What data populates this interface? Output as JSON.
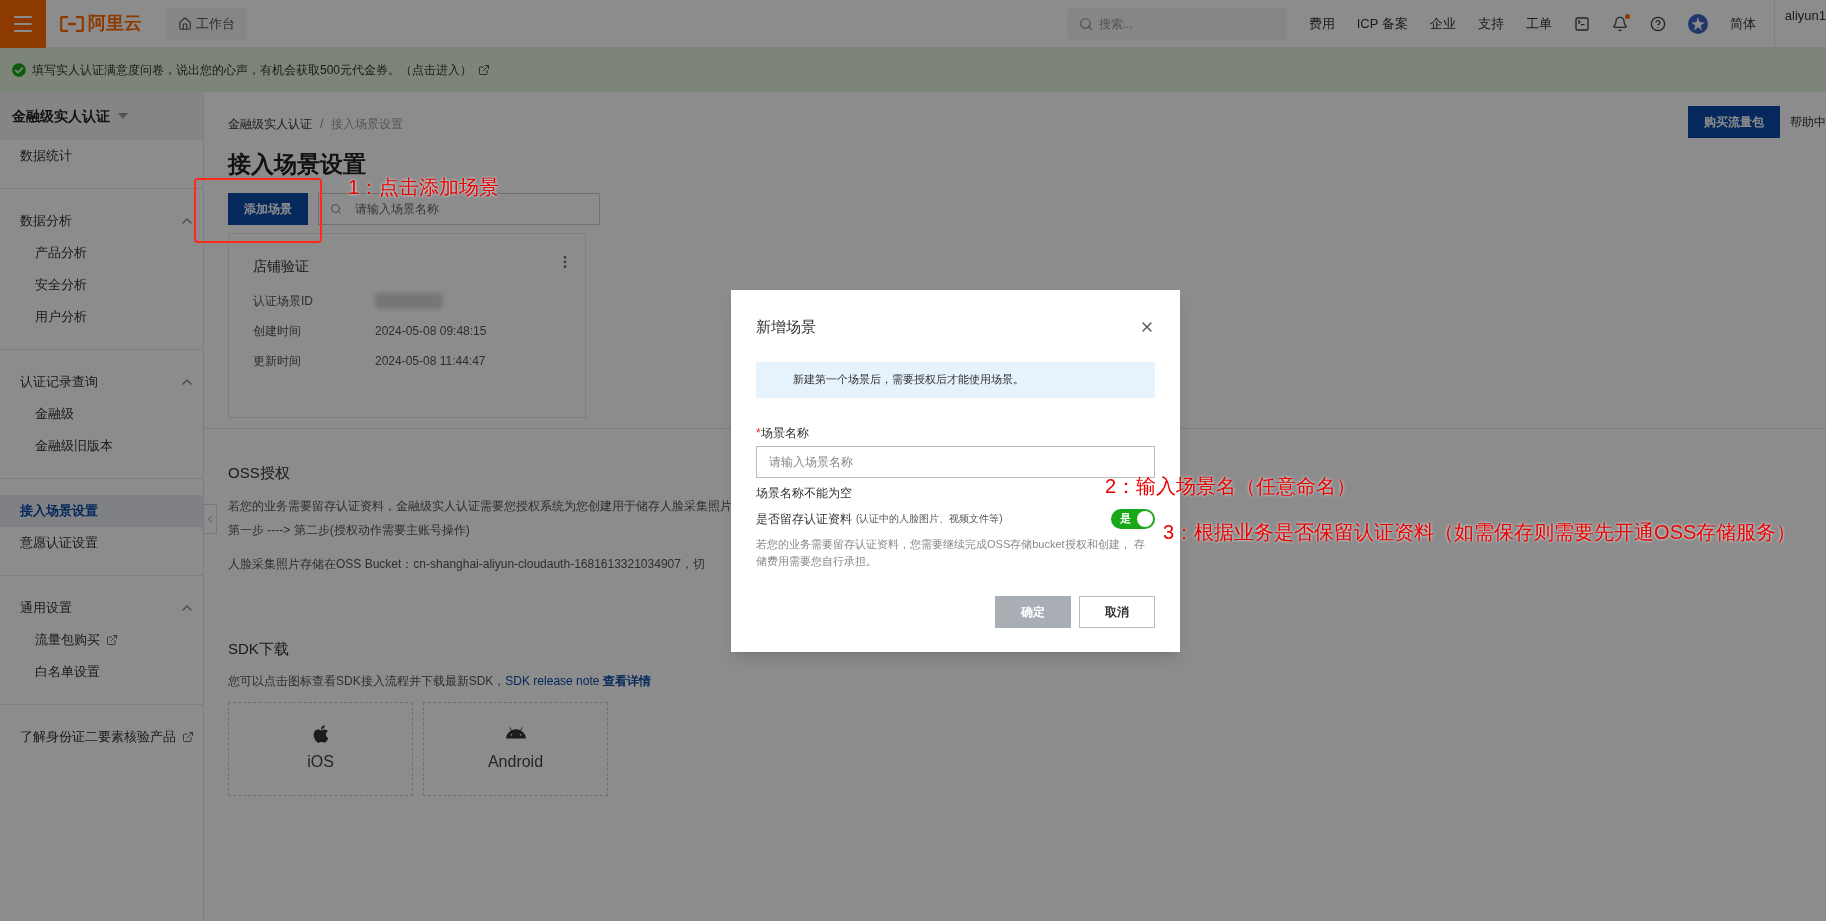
{
  "top_bar": {
    "logo_text": "阿里云",
    "workbench": "工作台",
    "search_placeholder": "搜索...",
    "nav_items": [
      "费用",
      "ICP 备案",
      "企业",
      "支持",
      "工单"
    ],
    "language": "简体",
    "user": "aliyun1",
    "has_notification": true
  },
  "notice": {
    "text": "填写实人认证满意度问卷，说出您的心声，有机会获取500元代金券。（点击进入）"
  },
  "sidebar": {
    "title": "金融级实人认证",
    "sections": [
      {
        "items": [
          {
            "label": "数据统计",
            "selected": false,
            "external": false
          }
        ]
      },
      {
        "items": [
          {
            "label": "数据分析",
            "selected": false,
            "external": false,
            "expanded": true,
            "children": [
              {
                "label": "产品分析",
                "selected": false,
                "external": false
              },
              {
                "label": "安全分析",
                "selected": false,
                "external": false
              },
              {
                "label": "用户分析",
                "selected": false,
                "external": false
              }
            ]
          }
        ]
      },
      {
        "items": [
          {
            "label": "认证记录查询",
            "selected": false,
            "external": false,
            "expanded": true,
            "children": [
              {
                "label": "金融级",
                "selected": false,
                "external": false
              },
              {
                "label": "金融级旧版本",
                "selected": false,
                "external": false
              }
            ]
          }
        ]
      },
      {
        "items": [
          {
            "label": "接入场景设置",
            "selected": true,
            "external": false
          },
          {
            "label": "意愿认证设置",
            "selected": false,
            "external": false
          }
        ]
      },
      {
        "items": [
          {
            "label": "通用设置",
            "selected": false,
            "external": false,
            "expanded": true,
            "children": [
              {
                "label": "流量包购买",
                "selected": false,
                "external": true
              },
              {
                "label": "白名单设置",
                "selected": false,
                "external": false
              }
            ]
          }
        ]
      },
      {
        "items": [
          {
            "label": "了解身份证二要素核验产品",
            "selected": false,
            "external": true
          }
        ]
      }
    ]
  },
  "main": {
    "breadcrumb": [
      "金融级实人认证",
      "接入场景设置"
    ],
    "breadcrumb_separator": "/",
    "title": "接入场景设置",
    "buy_button": "购买流量包",
    "help_text": "帮助中",
    "add_button": "添加场景",
    "search_placeholder": "请输入场景名称",
    "scene_cards": [
      {
        "name": "店铺验证",
        "fields": [
          {
            "label": "认证场景ID",
            "kind": "redacted"
          },
          {
            "label": "创建时间",
            "kind": "text",
            "value": "2024-05-08 09:48:15"
          },
          {
            "label": "更新时间",
            "kind": "text",
            "value": "2024-05-08 11:44:47"
          }
        ]
      }
    ],
    "oss": {
      "title": "OSS授权",
      "paragraphs": [
        "若您的业务需要留存认证资料，金融级实人认证需要您授权系统为您创建用于储存人脸采集照片",
        "第一步 ----> 第二步(授权动作需要主账号操作)",
        "人脸采集照片存储在OSS Bucket：cn-shanghai-aliyun-cloudauth-1681613321034907，切"
      ]
    },
    "sdk": {
      "title": "SDK下载",
      "text": "您可以点击图标查看SDK接入流程并下载最新SDK，",
      "link": "SDK release note **查看详情**",
      "platforms": [
        {
          "label": "iOS",
          "kind": "ios"
        },
        {
          "label": "Android",
          "kind": "android"
        }
      ]
    }
  },
  "dialog": {
    "title": "新增场景",
    "info": "新建第一个场景后，需要授权后才能使用场景。",
    "field_label": "场景名称",
    "required_mark": "*",
    "placeholder": "请输入场景名称",
    "error": "场景名称不能为空",
    "toggle": {
      "label": "是否留存认证资料",
      "hint": "(认证中的人脸图片、视频文件等)",
      "on": true,
      "text": "是"
    },
    "description": "若您的业务需要留存认证资料，您需要继续完成OSS存储bucket授权和创建， 存储费用需要您自行承担。",
    "buttons": [
      {
        "label": "确定",
        "kind": "primary",
        "disabled": true
      },
      {
        "label": "取消",
        "kind": "default",
        "disabled": false
      }
    ]
  },
  "annotations": [
    {
      "text": "1：点击添加场景"
    },
    {
      "text": "2：输入场景名（任意命名）"
    },
    {
      "text": "3：根据业务是否保留认证资料（如需保存则需要先开通OSS存储服务）"
    }
  ]
}
